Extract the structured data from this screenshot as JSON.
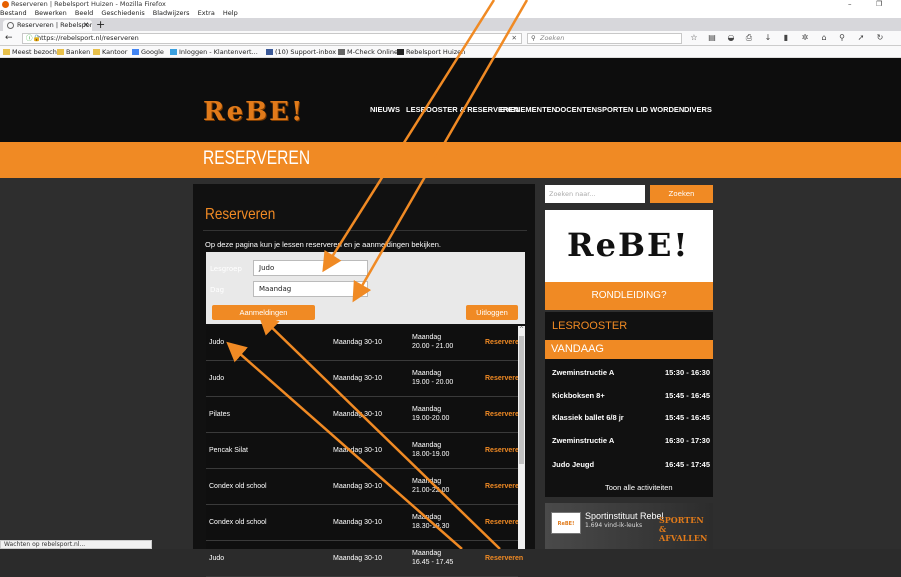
{
  "browser": {
    "window_title": "Reserveren | Rebelsport Huizen - Mozilla Firefox",
    "window_controls": [
      "–",
      "❐"
    ],
    "menu": [
      "Bestand",
      "Bewerken",
      "Beeld",
      "Geschiedenis",
      "Bladwijzers",
      "Extra",
      "Help"
    ],
    "tab_label": "Reserveren | Rebelsport Hui:",
    "tab_close": "✕",
    "new_tab": "+",
    "url": "https://rebelsport.nl/reserveren",
    "search_placeholder": "Zoeken",
    "bookmarks": [
      "Meest bezocht",
      "Banken",
      "Kantoor",
      "Google",
      "Inloggen - Klantenvert...",
      "(10) Support-inbox",
      "M-Check Online",
      "Rebelsport Huizen"
    ],
    "status": "Wachten op rebelsport.nl..."
  },
  "site": {
    "logo": "ReBE!",
    "nav": [
      "NIEUWS",
      "LESROOSTER & RESERVEREN",
      "EVENEMENTEN",
      "DOCENTEN",
      "SPORTEN",
      "LID WORDEN",
      "DIVERS"
    ],
    "page_title": "RESERVEREN"
  },
  "main": {
    "heading": "Reserveren",
    "intro": "Op deze pagina kun je lessen reserveren en je aanmeldingen bekijken.",
    "form": {
      "sport_label": "Lesgroep",
      "sport_value": "Judo",
      "day_label": "Dag",
      "day_value": "Maandag",
      "aanmeldingen_button": "Aanmeldingen",
      "uitloggen_button": "Uitloggen"
    },
    "rows": [
      {
        "name": "Judo",
        "date": "Maandag 30-10",
        "day": "Maandag",
        "time": "20.00 - 21.00",
        "action": "Reserveren"
      },
      {
        "name": "Judo",
        "date": "Maandag 30-10",
        "day": "Maandag",
        "time": "19.00 - 20.00",
        "action": "Reserveren"
      },
      {
        "name": "Pilates",
        "date": "Maandag 30-10",
        "day": "Maandag",
        "time": "19.00-20.00",
        "action": "Reserveren"
      },
      {
        "name": "Pencak Silat",
        "date": "Maandag 30-10",
        "day": "Maandag",
        "time": "18.00-19.00",
        "action": "Reserveren"
      },
      {
        "name": "Condex old school",
        "date": "Maandag 30-10",
        "day": "Maandag",
        "time": "21.00-22.00",
        "action": "Reserveren"
      },
      {
        "name": "Condex old school",
        "date": "Maandag 30-10",
        "day": "Maandag",
        "time": "18.30-19.30",
        "action": "Reserveren"
      },
      {
        "name": "Judo",
        "date": "Maandag 30-10",
        "day": "Maandag",
        "time": "16.45 - 17.45",
        "action": "Reserveren"
      }
    ]
  },
  "sidebar": {
    "search_placeholder": "Zoeken naar...",
    "search_button": "Zoeken",
    "logo": "ReBE!",
    "rondleiding": "RONDLEIDING?",
    "lesrooster_title": "LESROOSTER",
    "vandaag_title": "VANDAAG",
    "activities": [
      {
        "name": "Zweminstructie A",
        "time": "15:30 - 16:30"
      },
      {
        "name": "Kickboksen 8+",
        "time": "15:45 - 16:45"
      },
      {
        "name": "Klassiek ballet 6/8 jr",
        "time": "15:45 - 16:45"
      },
      {
        "name": "Zweminstructie A",
        "time": "16:30 - 17:30"
      },
      {
        "name": "Judo Jeugd",
        "time": "16:45 - 17:45"
      }
    ],
    "all_activities": "Toon alle activiteiten",
    "fb_name": "Sportinstituut Rebel",
    "fb_likes": "1.694 vind-ik-leuks",
    "fb_overlay": [
      "SPORTEN &",
      "AFVALLEN"
    ]
  },
  "colors": {
    "accent": "#f08a24",
    "header_bg": "#0d0d0d",
    "arrow": "#f08a24"
  }
}
